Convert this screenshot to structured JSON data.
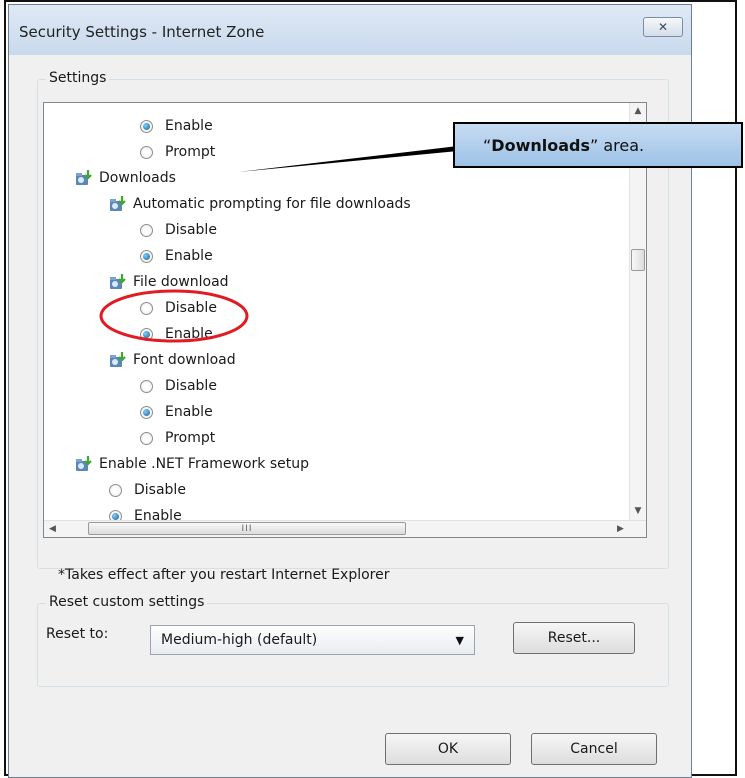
{
  "window": {
    "title": "Security Settings - Internet Zone",
    "close_glyph": "✕"
  },
  "settings_group": {
    "label": "Settings",
    "items": [
      {
        "kind": "radio",
        "label": "Enable",
        "checked": true,
        "indent": 1
      },
      {
        "kind": "radio",
        "label": "Prompt",
        "checked": false,
        "indent": 1
      },
      {
        "kind": "category",
        "label": "Downloads",
        "indent": 0
      },
      {
        "kind": "category",
        "label": "Automatic prompting for file downloads",
        "indent": 1
      },
      {
        "kind": "radio",
        "label": "Disable",
        "checked": false,
        "indent": 1
      },
      {
        "kind": "radio",
        "label": "Enable",
        "checked": true,
        "indent": 1
      },
      {
        "kind": "category",
        "label": "File download",
        "indent": 1
      },
      {
        "kind": "radio",
        "label": "Disable",
        "checked": false,
        "indent": 1
      },
      {
        "kind": "radio",
        "label": "Enable",
        "checked": true,
        "indent": 1
      },
      {
        "kind": "category",
        "label": "Font download",
        "indent": 1
      },
      {
        "kind": "radio",
        "label": "Disable",
        "checked": false,
        "indent": 1
      },
      {
        "kind": "radio",
        "label": "Enable",
        "checked": true,
        "indent": 1
      },
      {
        "kind": "radio",
        "label": "Prompt",
        "checked": false,
        "indent": 1
      },
      {
        "kind": "category",
        "label": "Enable .NET Framework setup",
        "indent": 0
      },
      {
        "kind": "radio",
        "label": "Disable",
        "checked": false,
        "indent": 0
      },
      {
        "kind": "radio",
        "label": "Enable",
        "checked": true,
        "indent": 0
      }
    ],
    "note": "*Takes effect after you restart Internet Explorer"
  },
  "reset_group": {
    "label": "Reset custom settings",
    "reset_to_label": "Reset to:",
    "selected_level": "Medium-high (default)",
    "reset_button": "Reset..."
  },
  "buttons": {
    "ok": "OK",
    "cancel": "Cancel"
  },
  "annotation": {
    "callout_quote_open": "“",
    "callout_bold": "Downloads",
    "callout_rest": "” area.",
    "highlight_color": "#e21b23",
    "callout_bg": "#b3d0ee"
  },
  "scrollbar": {
    "up": "▲",
    "down": "▼",
    "left": "◀",
    "right": "▶",
    "grip": "III"
  }
}
